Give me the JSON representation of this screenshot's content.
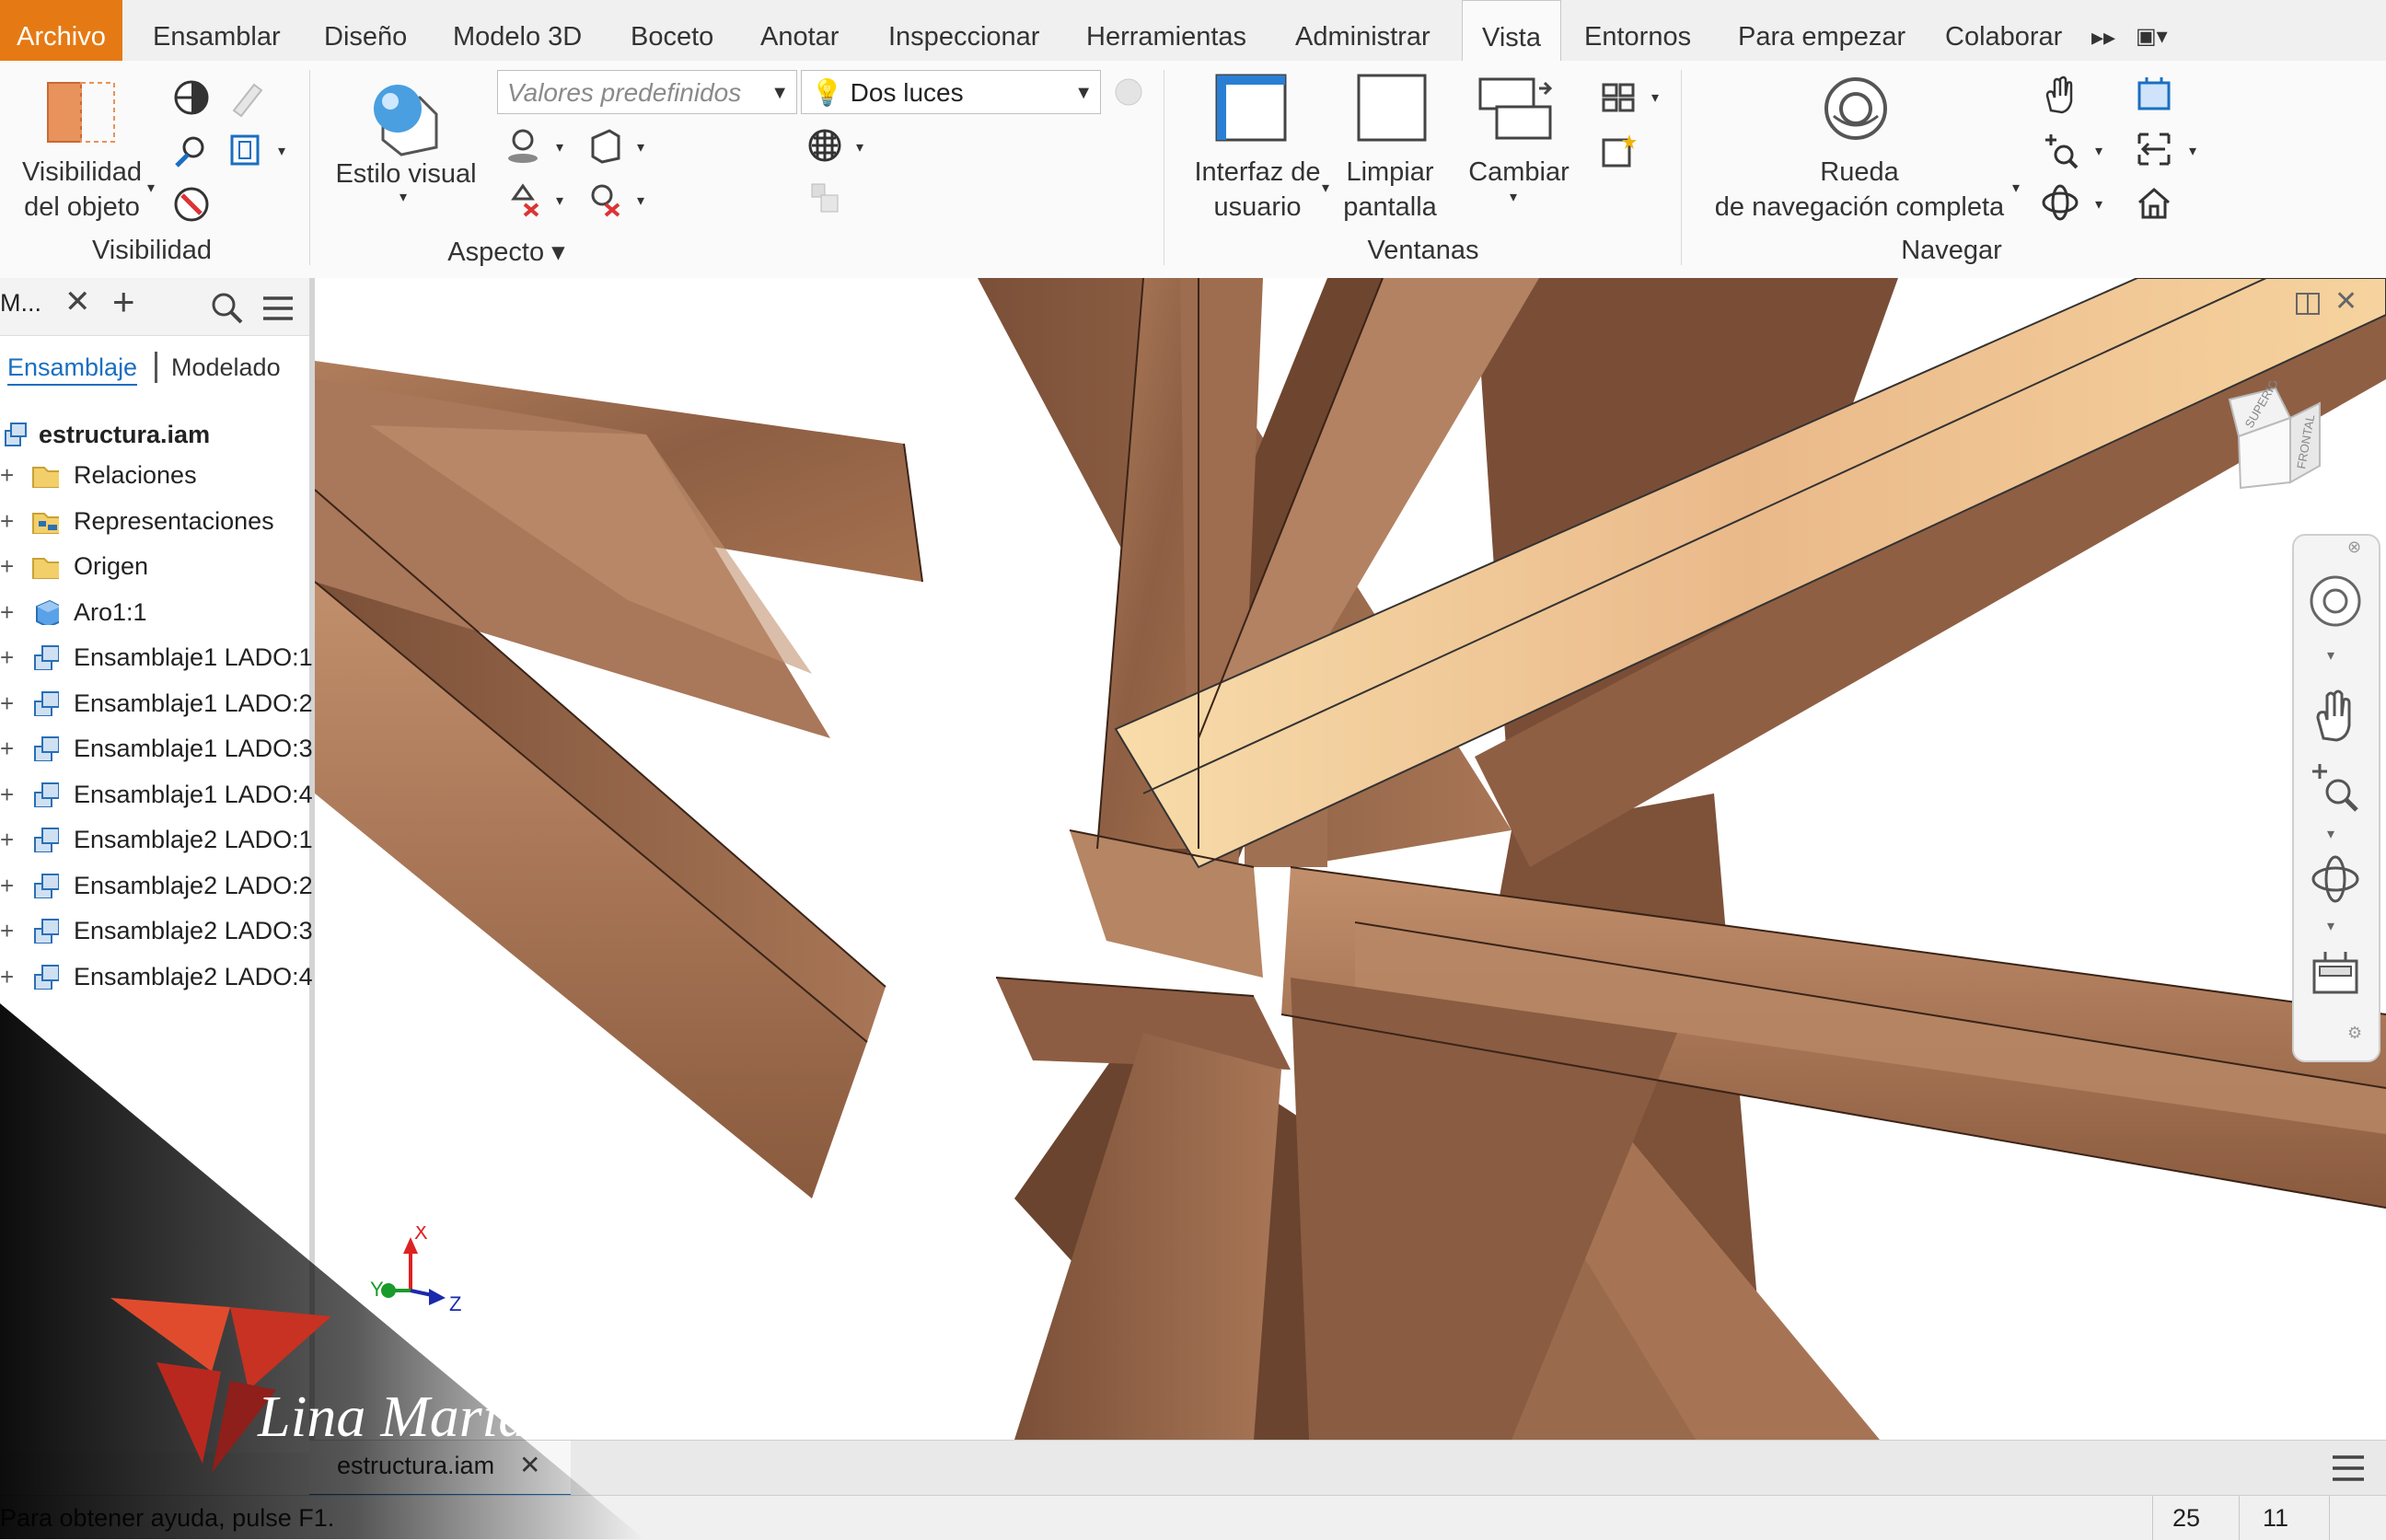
{
  "tabs": [
    "Archivo",
    "Ensamblar",
    "Diseño",
    "Modelo 3D",
    "Boceto",
    "Anotar",
    "Inspeccionar",
    "Herramientas",
    "Administrar",
    "Vista",
    "Entornos",
    "Para empezar",
    "Colaborar"
  ],
  "active_tab": "Vista",
  "ribbon": {
    "visibility": {
      "object_visibility_line1": "Visibilidad",
      "object_visibility_line2": "del objeto",
      "panel_label": "Visibilidad"
    },
    "appearance": {
      "visual_style": "Estilo visual",
      "preset_placeholder": "Valores predefinidos",
      "lighting": "Dos luces",
      "panel_label": "Aspecto"
    },
    "windows": {
      "ui_line1": "Interfaz de",
      "ui_line2": "usuario",
      "clean_line1": "Limpiar",
      "clean_line2": "pantalla",
      "switch": "Cambiar",
      "panel_label": "Ventanas"
    },
    "navigate": {
      "wheel_line1": "Rueda",
      "wheel_line2": "de navegación completa",
      "panel_label": "Navegar"
    }
  },
  "browser": {
    "title": "M...",
    "subtabs": [
      "Ensamblaje",
      "Modelado"
    ],
    "active_subtab": "Ensamblaje",
    "root": "estructura.iam",
    "items": [
      {
        "label": "Relaciones",
        "icon": "folder-icon"
      },
      {
        "label": "Representaciones",
        "icon": "representations-icon"
      },
      {
        "label": "Origen",
        "icon": "folder-icon"
      },
      {
        "label": "Aro1:1",
        "icon": "part-icon"
      },
      {
        "label": "Ensamblaje1 LADO:1",
        "icon": "assembly-icon"
      },
      {
        "label": "Ensamblaje1 LADO:2",
        "icon": "assembly-icon"
      },
      {
        "label": "Ensamblaje1 LADO:3",
        "icon": "assembly-icon"
      },
      {
        "label": "Ensamblaje1 LADO:4",
        "icon": "assembly-icon"
      },
      {
        "label": "Ensamblaje2 LADO:1",
        "icon": "assembly-icon"
      },
      {
        "label": "Ensamblaje2 LADO:2",
        "icon": "assembly-icon"
      },
      {
        "label": "Ensamblaje2 LADO:3",
        "icon": "assembly-icon"
      },
      {
        "label": "Ensamblaje2 LADO:4",
        "icon": "assembly-icon"
      }
    ]
  },
  "viewcube": {
    "top": "SUPERIOR",
    "front": "FRONTAL"
  },
  "triad": {
    "x": "X",
    "y": "Y",
    "z": "Z"
  },
  "document_tab": "estructura.iam",
  "status": {
    "help": "Para obtener ayuda, pulse F1.",
    "num1": "25",
    "num2": "11"
  },
  "watermark": "Lina María",
  "colors": {
    "file_tab": "#e57a14",
    "active_link": "#1a6fc0",
    "wood": "#9a6a4c",
    "wood_light": "#f5d5a0"
  }
}
